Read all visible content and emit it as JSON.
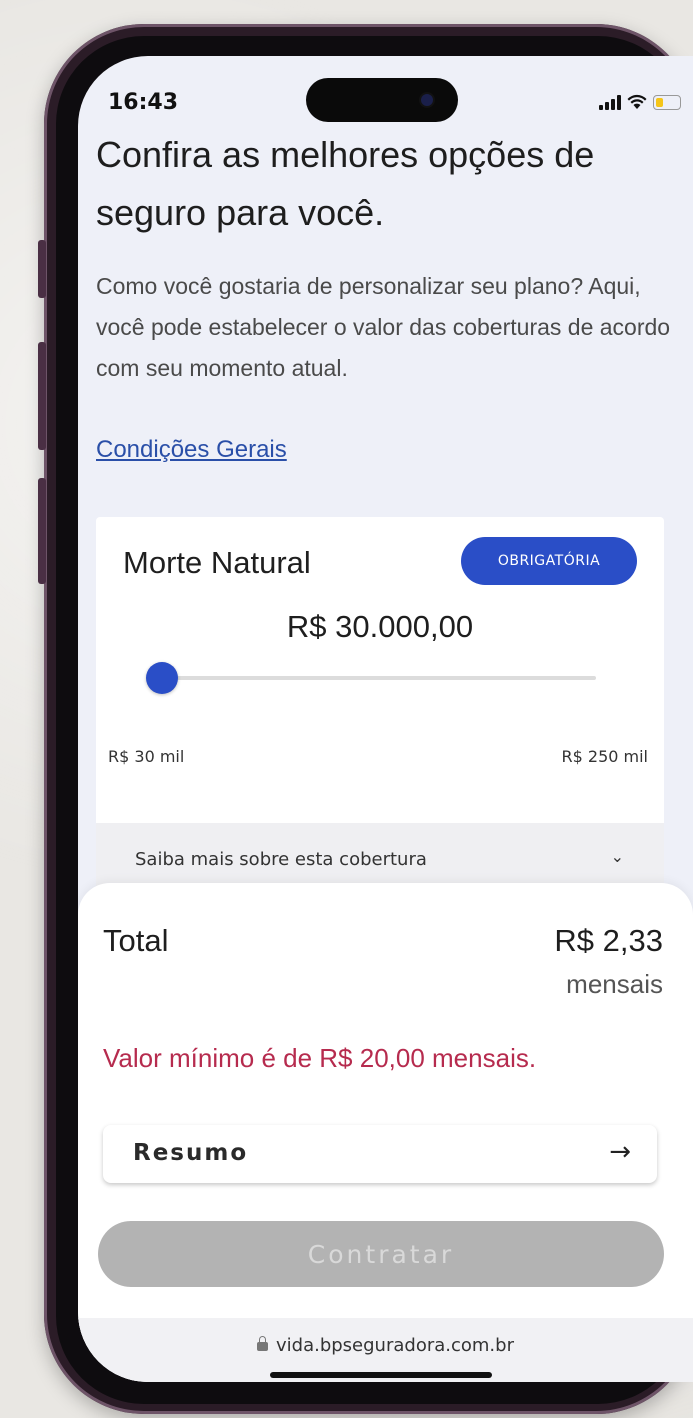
{
  "status_bar": {
    "time": "16:43",
    "battery_level": 0.35
  },
  "page": {
    "heading": "Confira as melhores opções de seguro para você.",
    "intro": "Como você gostaria de personalizar seu plano? Aqui, você pode estabelecer o valor das coberturas de acordo com seu momento atual.",
    "conditions_link": "Condições Gerais"
  },
  "coverage_card": {
    "title": "Morte Natural",
    "badge": "OBRIGATÓRIA",
    "amount": "R$ 30.000,00",
    "slider_value": 30000,
    "slider_min": 30000,
    "slider_max": 250000,
    "min_label": "R$ 30 mil",
    "max_label": "R$ 250 mil",
    "more_info": "Saiba mais sobre esta cobertura"
  },
  "summary": {
    "total_label": "Total",
    "total_value": "R$ 2,33",
    "total_period": "mensais",
    "warning": "Valor mínimo é de R$ 20,00 mensais.",
    "resumo_label": "Resumo",
    "contratar_label": "Contratar"
  },
  "browser": {
    "url": "vida.bpseguradora.com.br"
  },
  "colors": {
    "primary": "#2a4ec7",
    "warning": "#b62b4e",
    "disabled": "#b3b3b3"
  }
}
